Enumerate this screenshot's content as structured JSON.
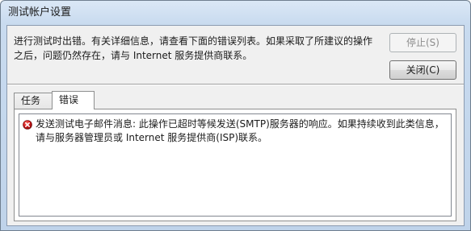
{
  "window": {
    "title": "测试帐户设置"
  },
  "header": {
    "message": "进行测试时出错。有关详细信息，请查看下面的错误列表。如果采取了所建议的操作之后，问题仍然存在，请与 Internet 服务提供商联系。"
  },
  "buttons": {
    "stop_label": "停止(S)",
    "close_label": "关闭(C)"
  },
  "tabs": [
    {
      "label": "任务",
      "selected": false
    },
    {
      "label": "错误",
      "selected": true
    }
  ],
  "errors": [
    {
      "icon": "error-icon",
      "text": "发送测试电子邮件消息: 此操作已超时等候发送(SMTP)服务器的响应。如果持续收到此类信息，请与服务器管理员或 Internet 服务提供商(ISP)联系。"
    }
  ]
}
